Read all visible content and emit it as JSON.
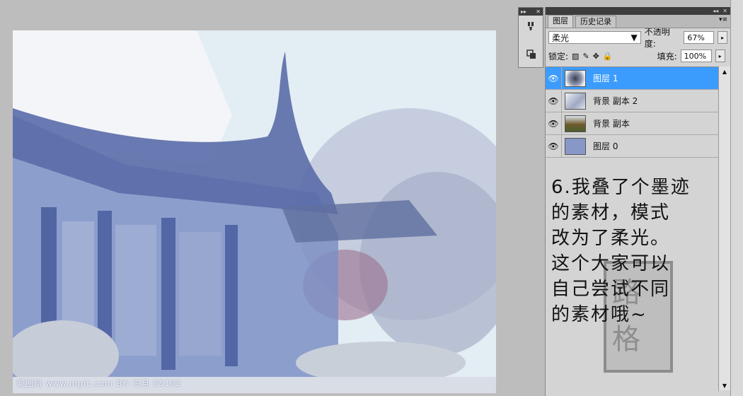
{
  "canvas": {
    "watermark": "昵图网 www.nipic.com  BY: 冷月 85102",
    "watermark_small": "..."
  },
  "mini_panel": {
    "buttons": [
      {
        "icon": "brush-presets-icon"
      },
      {
        "icon": "clone-source-icon"
      }
    ]
  },
  "layers_panel": {
    "tabs": [
      {
        "label": "图层",
        "active": true
      },
      {
        "label": "历史记录",
        "active": false
      }
    ],
    "blend_mode": "柔光",
    "opacity_label": "不透明度:",
    "opacity_value": "67%",
    "lock_label": "锁定:",
    "fill_label": "填充:",
    "fill_value": "100%",
    "layers": [
      {
        "name": "图层 1",
        "visible": true,
        "selected": true,
        "thumb_color": "#6b7b9c"
      },
      {
        "name": "背景 副本 2",
        "visible": true,
        "selected": false,
        "thumb_color": "#c9cdd8"
      },
      {
        "name": "背景 副本",
        "visible": true,
        "selected": false,
        "thumb_color": "#7b6a3f"
      },
      {
        "name": "图层 0",
        "visible": true,
        "selected": false,
        "thumb_color": "#8797c8"
      }
    ],
    "note_lines": [
      "6.我叠了个墨迹",
      "的素材，模式",
      "改为了柔光。",
      "这个大家可以",
      "自己尝试不同",
      "的素材哦~"
    ]
  },
  "colors": {
    "selection": "#3c9cfd",
    "panel_bg": "#d4d4d4",
    "workspace_bg": "#bdbdbd"
  }
}
